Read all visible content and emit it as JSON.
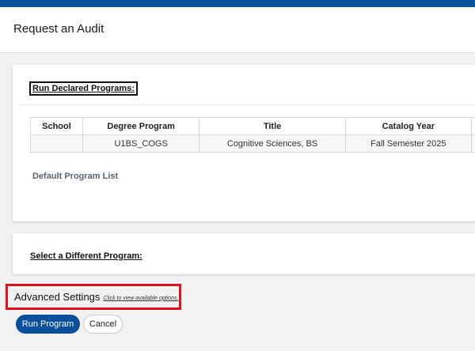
{
  "header": {
    "title": "Request an Audit"
  },
  "declared": {
    "heading": "Run Declared Programs:",
    "columns": [
      "School",
      "Degree Program",
      "Title",
      "Catalog Year"
    ],
    "rows": [
      {
        "school": "",
        "degree_program": "U1BS_COGS",
        "title": "Cognitive Sciences, BS",
        "catalog_year": "Fall Semester 2025"
      }
    ],
    "default_list": "Default Program List"
  },
  "different": {
    "heading": "Select a Different Program:"
  },
  "advanced": {
    "label": "Advanced Settings",
    "link": "Click to view available options."
  },
  "actions": {
    "run_label": "Run Program",
    "cancel_label": "Cancel"
  },
  "colors": {
    "brand_blue": "#0a4f9c",
    "highlight_red": "#e0121c"
  }
}
